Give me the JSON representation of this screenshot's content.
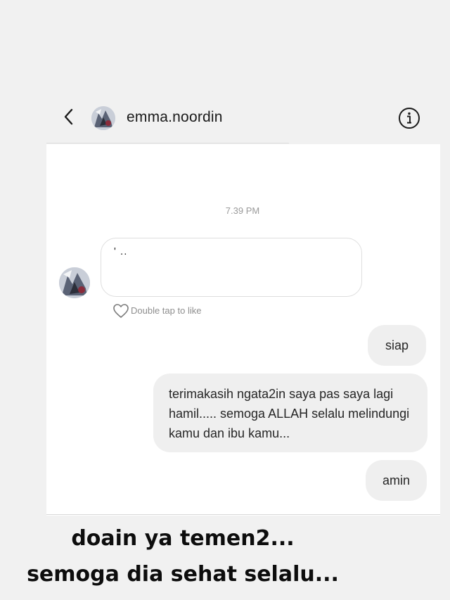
{
  "header": {
    "username": "emma.noordin",
    "back_icon": "chevron-left-icon",
    "info_icon": "info-circle-icon"
  },
  "conversation": {
    "timestamp": "7.39 PM",
    "incoming": {
      "text": "' ..",
      "like_hint": "Double tap to like"
    },
    "outgoing": [
      {
        "text": "siap"
      },
      {
        "text": "terimakasih ngata2in saya pas saya lagi hamil..... semoga ALLAH selalu melindungi kamu dan ibu kamu..."
      },
      {
        "text": "amin"
      }
    ]
  },
  "caption": {
    "line1": "doain ya temen2...",
    "line2": "semoga dia sehat selalu..."
  },
  "colors": {
    "background": "#f1f1f1",
    "panel": "#ffffff",
    "outgoing_bubble": "#efefef",
    "muted_text": "#8e8e8e"
  }
}
